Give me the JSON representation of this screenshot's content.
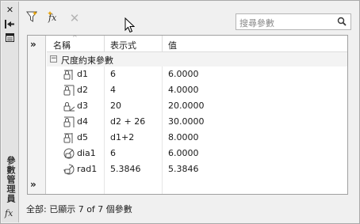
{
  "palette": {
    "title": "參數管理員"
  },
  "toolbar": {
    "new_icon": "filter-icon",
    "fx_icon": "fx-icon",
    "delete_icon": "delete-x-icon"
  },
  "search": {
    "placeholder": "搜尋參數"
  },
  "grid": {
    "columns": [
      "名稱",
      "表示式",
      "值"
    ],
    "group": "尺度約束參數",
    "rows": [
      {
        "name": "d1",
        "expr": "6",
        "value": "6.0000",
        "icon": "linear-dimension-icon"
      },
      {
        "name": "d2",
        "expr": "4",
        "value": "4.0000",
        "icon": "linear-dimension-icon"
      },
      {
        "name": "d3",
        "expr": "20",
        "value": "20.0000",
        "icon": "angular-dimension-icon"
      },
      {
        "name": "d4",
        "expr": "d2 + 26",
        "value": "30.0000",
        "icon": "linear-dimension-icon"
      },
      {
        "name": "d5",
        "expr": "d1+2",
        "value": "8.0000",
        "icon": "linear-dimension-icon"
      },
      {
        "name": "dia1",
        "expr": "6",
        "value": "6.0000",
        "icon": "diameter-dimension-icon"
      },
      {
        "name": "rad1",
        "expr": "5.3846",
        "value": "5.3846",
        "icon": "radius-dimension-icon"
      }
    ]
  },
  "status": {
    "text": "全部: 已顯示 7 of 7 個參數"
  }
}
